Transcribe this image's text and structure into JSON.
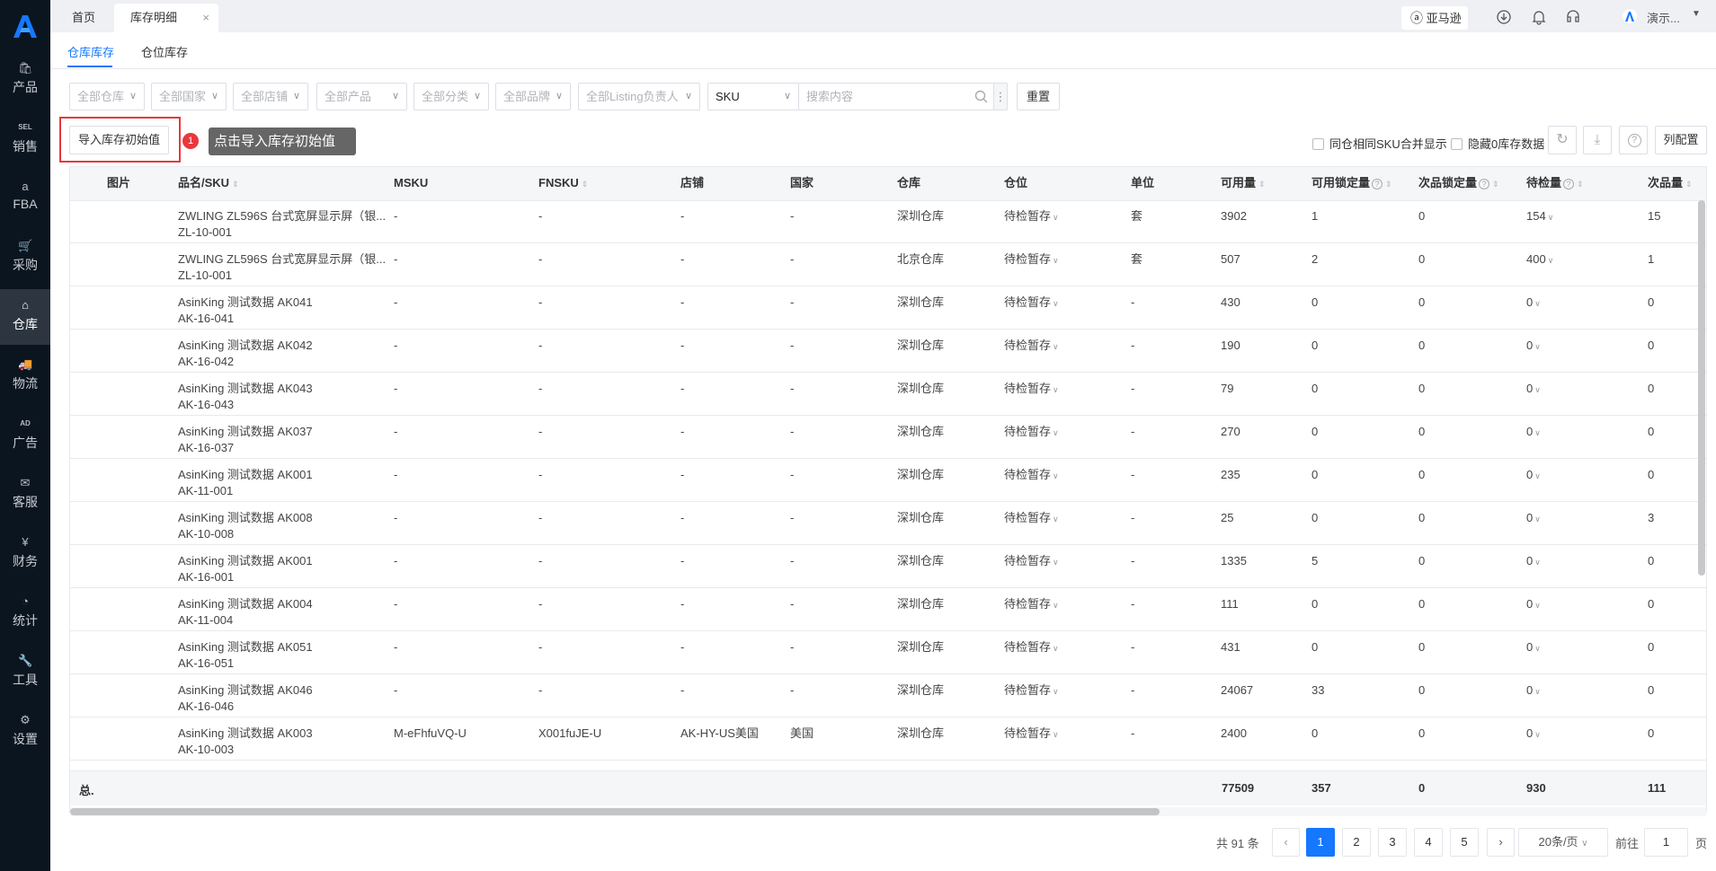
{
  "sidebar": {
    "items": [
      {
        "label": "产品",
        "icon": "bag-icon"
      },
      {
        "label": "销售",
        "icon": "sel-icon"
      },
      {
        "label": "FBA",
        "icon": "amazon-icon"
      },
      {
        "label": "采购",
        "icon": "cart-icon"
      },
      {
        "label": "仓库",
        "icon": "warehouse-icon",
        "active": true
      },
      {
        "label": "物流",
        "icon": "truck-icon"
      },
      {
        "label": "广告",
        "icon": "ad-icon"
      },
      {
        "label": "客服",
        "icon": "mail-icon"
      },
      {
        "label": "财务",
        "icon": "yen-icon"
      },
      {
        "label": "统计",
        "icon": "pie-icon"
      },
      {
        "label": "工具",
        "icon": "wrench-icon"
      },
      {
        "label": "设置",
        "icon": "gear-icon"
      }
    ]
  },
  "topbar": {
    "tabs": [
      "首页",
      "库存明细"
    ],
    "close": "×",
    "marketplace": "亚马逊",
    "user": "演示..."
  },
  "subtabs": [
    "仓库库存",
    "仓位库存"
  ],
  "filters": {
    "selects": [
      "全部仓库",
      "全部国家",
      "全部店铺",
      "全部产品",
      "全部分类",
      "全部品牌",
      "全部Listing负责人"
    ],
    "search_type": "SKU",
    "search_placeholder": "搜索内容",
    "reset": "重置"
  },
  "toolbar": {
    "import": "导入库存初始值",
    "tip_step": "1",
    "tip": "点击导入库存初始值",
    "merge_sku": "同仓相同SKU合并显示",
    "hide_zero": "隐藏0库存数据",
    "columns": "列配置"
  },
  "table": {
    "headers": [
      "图片",
      "品名/SKU",
      "MSKU",
      "FNSKU",
      "店铺",
      "国家",
      "仓库",
      "仓位",
      "单位",
      "可用量",
      "可用锁定量",
      "次品锁定量",
      "待检量",
      "次品量"
    ],
    "rows": [
      [
        "ZWLING ZL596S 台式宽屏显示屏（银...",
        "ZL-10-001",
        "-",
        "-",
        "-",
        "-",
        "深圳仓库",
        "待检暂存",
        "套",
        "3902",
        "1",
        "0",
        "154",
        "15"
      ],
      [
        "ZWLING ZL596S 台式宽屏显示屏（银...",
        "ZL-10-001",
        "-",
        "-",
        "-",
        "-",
        "北京仓库",
        "待检暂存",
        "套",
        "507",
        "2",
        "0",
        "400",
        "1"
      ],
      [
        "AsinKing 测试数据 AK041",
        "AK-16-041",
        "-",
        "-",
        "-",
        "-",
        "深圳仓库",
        "待检暂存",
        "-",
        "430",
        "0",
        "0",
        "0",
        "0"
      ],
      [
        "AsinKing 测试数据 AK042",
        "AK-16-042",
        "-",
        "-",
        "-",
        "-",
        "深圳仓库",
        "待检暂存",
        "-",
        "190",
        "0",
        "0",
        "0",
        "0"
      ],
      [
        "AsinKing 测试数据 AK043",
        "AK-16-043",
        "-",
        "-",
        "-",
        "-",
        "深圳仓库",
        "待检暂存",
        "-",
        "79",
        "0",
        "0",
        "0",
        "0"
      ],
      [
        "AsinKing 测试数据 AK037",
        "AK-16-037",
        "-",
        "-",
        "-",
        "-",
        "深圳仓库",
        "待检暂存",
        "-",
        "270",
        "0",
        "0",
        "0",
        "0"
      ],
      [
        "AsinKing 测试数据 AK001",
        "AK-11-001",
        "-",
        "-",
        "-",
        "-",
        "深圳仓库",
        "待检暂存",
        "-",
        "235",
        "0",
        "0",
        "0",
        "0"
      ],
      [
        "AsinKing 测试数据 AK008",
        "AK-10-008",
        "-",
        "-",
        "-",
        "-",
        "深圳仓库",
        "待检暂存",
        "-",
        "25",
        "0",
        "0",
        "0",
        "3"
      ],
      [
        "AsinKing 测试数据 AK001",
        "AK-16-001",
        "-",
        "-",
        "-",
        "-",
        "深圳仓库",
        "待检暂存",
        "-",
        "1335",
        "5",
        "0",
        "0",
        "0"
      ],
      [
        "AsinKing 测试数据 AK004",
        "AK-11-004",
        "-",
        "-",
        "-",
        "-",
        "深圳仓库",
        "待检暂存",
        "-",
        "111",
        "0",
        "0",
        "0",
        "0"
      ],
      [
        "AsinKing 测试数据 AK051",
        "AK-16-051",
        "-",
        "-",
        "-",
        "-",
        "深圳仓库",
        "待检暂存",
        "-",
        "431",
        "0",
        "0",
        "0",
        "0"
      ],
      [
        "AsinKing 测试数据 AK046",
        "AK-16-046",
        "-",
        "-",
        "-",
        "-",
        "深圳仓库",
        "待检暂存",
        "-",
        "24067",
        "33",
        "0",
        "0",
        "0"
      ],
      [
        "AsinKing 测试数据 AK003",
        "AK-10-003",
        "M-eFhfuVQ-U",
        "X001fuJE-U",
        "AK-HY-US美国",
        "美国",
        "深圳仓库",
        "待检暂存",
        "-",
        "2400",
        "0",
        "0",
        "0",
        "0"
      ]
    ],
    "summary": {
      "label": "总.",
      "available": "77509",
      "available_locked": "357",
      "defect_locked": "0",
      "pending": "930",
      "defect": "111"
    }
  },
  "pagination": {
    "total": "共 91 条",
    "pages": [
      "1",
      "2",
      "3",
      "4",
      "5"
    ],
    "current": "1",
    "page_size": "20条/页",
    "goto": "前往",
    "goto_value": "1",
    "page_unit": "页"
  },
  "colors": {
    "accent": "#1677ff",
    "highlight": "#e8383d",
    "sidebar": "#0b1520"
  }
}
